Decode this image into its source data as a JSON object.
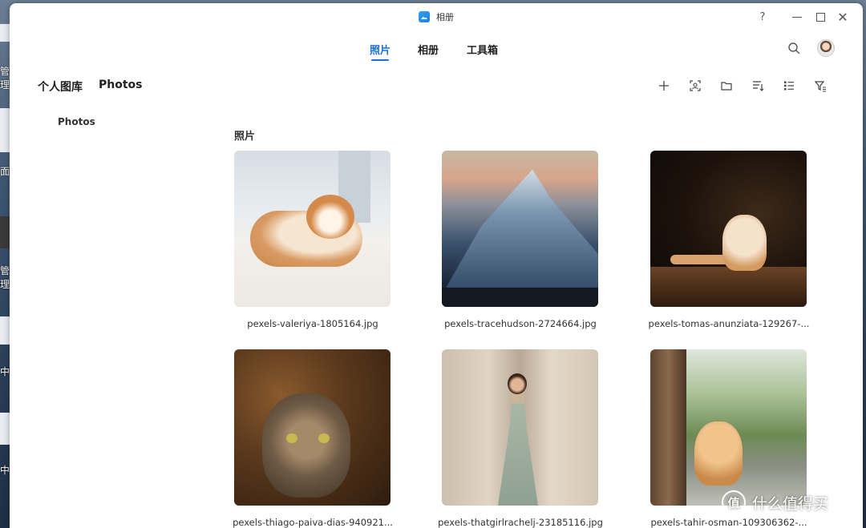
{
  "desktop": {
    "fragments": [
      "管理",
      "面",
      "管理",
      "中",
      "中"
    ]
  },
  "window": {
    "app_title": "相册",
    "help_label": "?"
  },
  "nav": {
    "tabs": [
      {
        "label": "照片",
        "active": true
      },
      {
        "label": "相册",
        "active": false
      },
      {
        "label": "工具箱",
        "active": false
      }
    ]
  },
  "breadcrumb": [
    "个人图库",
    "Photos"
  ],
  "toolbar": {
    "icons": [
      "plus-icon",
      "face-scan-icon",
      "folder-icon",
      "sort-icon",
      "list-view-icon",
      "filter-icon"
    ]
  },
  "sidebar": {
    "items": [
      {
        "label": "Photos"
      }
    ]
  },
  "main": {
    "section_title": "照片",
    "photos": [
      {
        "caption": "pexels-valeriya-1805164.jpg"
      },
      {
        "caption": "pexels-tracehudson-2724664.jpg"
      },
      {
        "caption": "pexels-tomas-anunziata-129267-..."
      },
      {
        "caption": "pexels-thiago-paiva-dias-940921..."
      },
      {
        "caption": "pexels-thatgirlrachelj-23185116.jpg"
      },
      {
        "caption": "pexels-tahir-osman-109306362-..."
      }
    ]
  },
  "watermark": {
    "logo_text": "值",
    "text": "什么值得买"
  },
  "colors": {
    "accent": "#1a6fd8",
    "text": "#222222"
  }
}
